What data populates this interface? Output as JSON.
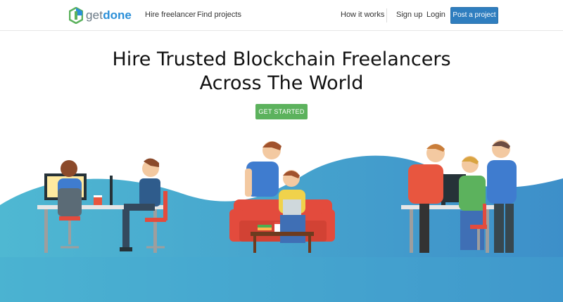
{
  "brand": {
    "name_part1": "get",
    "name_part2": "done"
  },
  "nav": {
    "hire_freelancer": "Hire freelancer",
    "find_projects": "Find projects",
    "how_it_works": "How it works",
    "sign_up": "Sign up",
    "login": "Login",
    "post_project": "Post a project"
  },
  "hero": {
    "title_line1": "Hire Trusted Blockchain Freelancers",
    "title_line2": "Across The World",
    "cta": "GET STARTED"
  },
  "colors": {
    "accent": "#2f7ebf",
    "cta_green": "#5cb25d",
    "logo_green": "#5cb25d",
    "logo_blue": "#2b8fd8",
    "wave_light": "#4fb8d2",
    "wave_dark": "#3d8fc9"
  },
  "icons": [
    "logo-hexagon-icon"
  ]
}
